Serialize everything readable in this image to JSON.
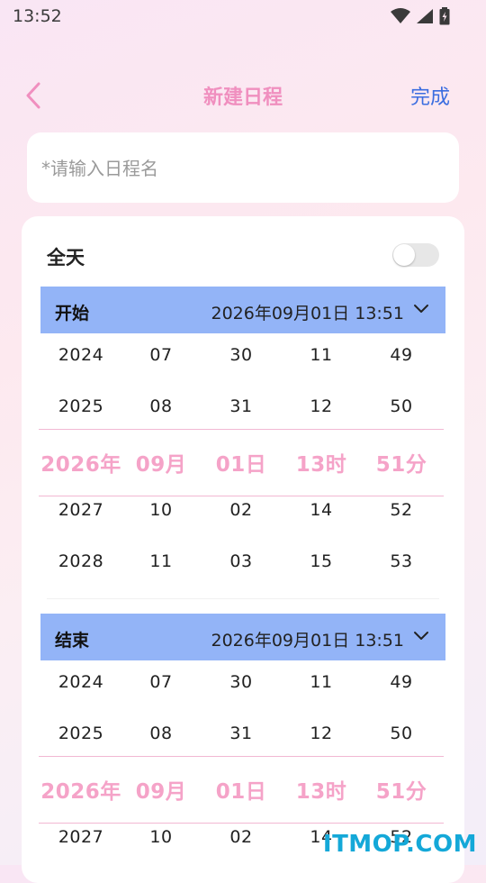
{
  "status_bar": {
    "time": "13:52"
  },
  "nav": {
    "title": "新建日程",
    "done_label": "完成"
  },
  "name_input": {
    "placeholder": "*请输入日程名",
    "value": ""
  },
  "all_day": {
    "label": "全天",
    "on": false
  },
  "start": {
    "label": "开始",
    "value": "2026年09月01日 13:51",
    "rows": [
      [
        "2024",
        "07",
        "30",
        "11",
        "49"
      ],
      [
        "2025",
        "08",
        "31",
        "12",
        "50"
      ],
      [
        "2026年",
        "09月",
        "01日",
        "13时",
        "51分"
      ],
      [
        "2027",
        "10",
        "02",
        "14",
        "52"
      ],
      [
        "2028",
        "11",
        "03",
        "15",
        "53"
      ]
    ]
  },
  "end": {
    "label": "结束",
    "value": "2026年09月01日 13:51",
    "rows": [
      [
        "2024",
        "07",
        "30",
        "11",
        "49"
      ],
      [
        "2025",
        "08",
        "31",
        "12",
        "50"
      ],
      [
        "2026年",
        "09月",
        "01日",
        "13时",
        "51分"
      ],
      [
        "2027",
        "10",
        "02",
        "14",
        "52"
      ]
    ]
  },
  "colors": {
    "accent_pink": "#f08fbf",
    "selected_pink": "#f5a3c8",
    "link_blue": "#3b6de0",
    "section_blue": "#93b4f7"
  },
  "watermark": "ITMOP.COM"
}
